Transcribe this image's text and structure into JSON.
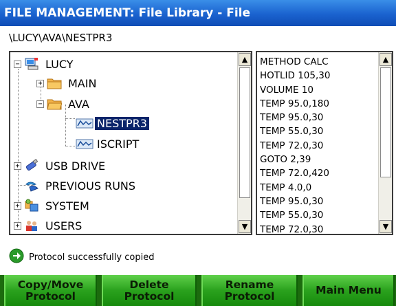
{
  "title": "FILE MANAGEMENT: File Library - File",
  "path": "\\LUCY\\AVA\\NESTPR3",
  "tree": {
    "items": [
      {
        "label": "LUCY",
        "icon": "computer-icon",
        "expander": "−"
      },
      {
        "label": "MAIN",
        "icon": "folder-icon",
        "expander": "+"
      },
      {
        "label": "AVA",
        "icon": "folder-open-icon",
        "expander": "−"
      },
      {
        "label": "NESTPR3",
        "icon": "protocol-file-icon",
        "expander": ""
      },
      {
        "label": "ISCRIPT",
        "icon": "protocol-file-icon",
        "expander": ""
      },
      {
        "label": "USB DRIVE",
        "icon": "usb-drive-icon",
        "expander": "+"
      },
      {
        "label": "PREVIOUS RUNS",
        "icon": "previous-runs-icon",
        "expander": ""
      },
      {
        "label": "SYSTEM",
        "icon": "system-icon",
        "expander": "+"
      },
      {
        "label": "USERS",
        "icon": "users-icon",
        "expander": "+"
      }
    ],
    "selected": "NESTPR3"
  },
  "protocol_lines": [
    "METHOD CALC",
    "HOTLID 105,30",
    "VOLUME 10",
    "TEMP 95.0,180",
    "TEMP 95.0,30",
    "TEMP 55.0,30",
    "TEMP 72.0,30",
    "GOTO 2,39",
    "TEMP 72.0,420",
    "TEMP 4.0,0",
    "TEMP 95.0,30",
    "TEMP 55.0,30",
    "TEMP 72.0,30"
  ],
  "status": {
    "icon": "arrow-right-circle-icon",
    "text": "Protocol successfully copied"
  },
  "buttons": {
    "copy_move": "Copy/Move\nProtocol",
    "delete": "Delete\nProtocol",
    "rename": "Rename\nProtocol",
    "main_menu": "Main Menu"
  },
  "colors": {
    "title_bar": "#1a62cf",
    "selection": "#0a246a",
    "button_green": "#2aa11d"
  }
}
